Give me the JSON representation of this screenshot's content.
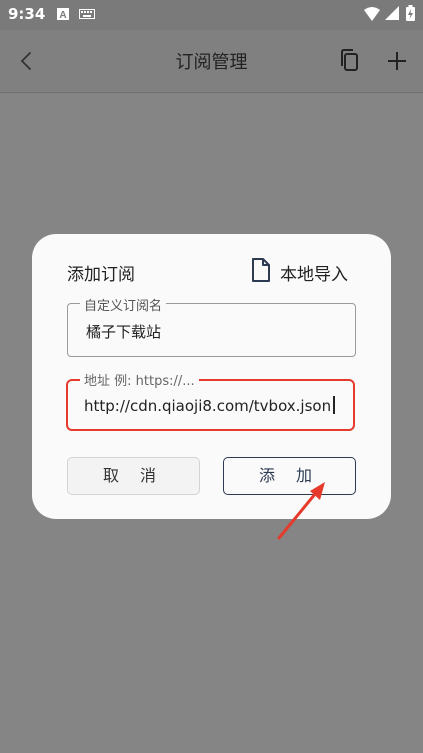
{
  "status_bar": {
    "time": "9:34",
    "icons": [
      "a-icon",
      "keyboard-icon",
      "wifi-icon",
      "signal-icon",
      "battery-icon"
    ]
  },
  "app_bar": {
    "title": "订阅管理",
    "icons": [
      "back-arrow-icon",
      "copy-icon",
      "add-icon"
    ]
  },
  "dialog": {
    "title": "添加订阅",
    "import_label": "本地导入",
    "name_field": {
      "label": "自定义订阅名",
      "value": "橘子下载站"
    },
    "url_field": {
      "label": "地址 例: https://...",
      "value": "http://cdn.qiaoji8.com/tvbox.json"
    },
    "cancel_label": "取 消",
    "add_label": "添 加"
  },
  "colors": {
    "highlight_border": "#e53a2c",
    "primary": "#2c3a52",
    "overlay": "#858585"
  }
}
